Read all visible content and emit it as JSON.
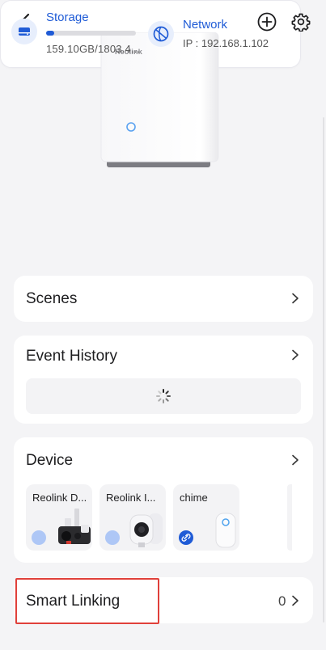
{
  "topbar": {
    "back_icon": "chevron-left-icon",
    "add_icon": "plus-circle-icon",
    "settings_icon": "gear-icon"
  },
  "hub": {
    "brand": "Reolink"
  },
  "storage": {
    "label": "Storage",
    "value": "159.10GB/1803.4...",
    "usage_fraction": 0.088
  },
  "network": {
    "label": "Network",
    "ip": "IP : 192.168.1.102"
  },
  "scenes": {
    "title": "Scenes"
  },
  "event_history": {
    "title": "Event History"
  },
  "device": {
    "title": "Device",
    "items": [
      {
        "name": "Reolink D..."
      },
      {
        "name": "Reolink I..."
      },
      {
        "name": "chime"
      }
    ]
  },
  "smart_linking": {
    "title": "Smart Linking",
    "count": "0"
  },
  "colors": {
    "accent": "#1f5bd6",
    "highlight_border": "#e0403a",
    "background": "#f4f4f6"
  }
}
